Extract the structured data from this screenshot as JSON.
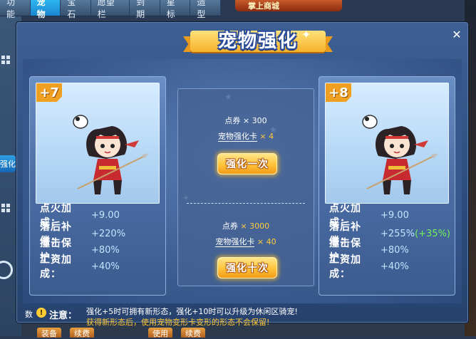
{
  "top_tabs": [
    {
      "label": "功能"
    },
    {
      "label": "宠物",
      "active": true
    },
    {
      "label": "宝石"
    },
    {
      "label": "愿望栏"
    },
    {
      "label": "到期"
    },
    {
      "label": "星标"
    },
    {
      "label": "造型"
    }
  ],
  "top_banner": {
    "label": "掌上商城"
  },
  "side": {
    "label": "强化"
  },
  "bottom_buttons": [
    {
      "label": "装备"
    },
    {
      "label": "续费"
    },
    {
      "label": "使用"
    },
    {
      "label": "续费"
    }
  ],
  "dialog": {
    "title": "宠物强化",
    "close_label": "✕"
  },
  "pet_left": {
    "level": "+7",
    "stats": [
      {
        "label": "点火加成：",
        "value": "+9.00",
        "extra": ""
      },
      {
        "label": "落后补偿：",
        "value": "+220%",
        "extra": ""
      },
      {
        "label": "撞击保护：",
        "value": "+80%",
        "extra": ""
      },
      {
        "label": "工资加成：",
        "value": "+40%",
        "extra": ""
      }
    ]
  },
  "pet_right": {
    "level": "+8",
    "stats": [
      {
        "label": "点火加成：",
        "value": "+9.00",
        "extra": ""
      },
      {
        "label": "落后补偿：",
        "value": "+255%",
        "extra": "(+35%)"
      },
      {
        "label": "撞击保护：",
        "value": "+80%",
        "extra": ""
      },
      {
        "label": "工资加成：",
        "value": "+40%",
        "extra": ""
      }
    ]
  },
  "enhance_once": {
    "coupon_label": "点券",
    "coupon_qty": "× 300",
    "card_label": "宠物强化卡",
    "card_qty": "× 4",
    "button_label": "强化一次"
  },
  "enhance_ten": {
    "coupon_label": "点券",
    "coupon_qty": "× 3000",
    "card_label": "宠物强化卡",
    "card_qty": "× 40",
    "button_label": "强化十次"
  },
  "notice": {
    "num": "数",
    "icon_glyph": "!",
    "label": "注意：",
    "line1": "强化+5时可拥有新形态，强化+10时可以升级为休闲区骑宠!",
    "line2": "获得新形态后，使用宠物变形卡变形的形态不会保留!"
  },
  "colors": {
    "accent_gold": "#ffc33a",
    "stat_value": "#bfe6ff",
    "stat_bonus": "#74f05a",
    "tab_active": "#1886d0"
  }
}
